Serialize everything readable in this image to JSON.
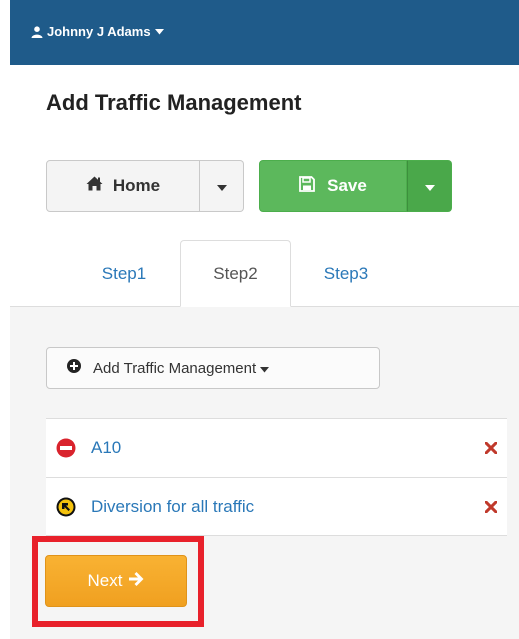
{
  "user": {
    "name": "Johnny J Adams"
  },
  "page": {
    "title": "Add Traffic Management"
  },
  "toolbar": {
    "home_label": "Home",
    "save_label": "Save"
  },
  "tabs": [
    {
      "label": "Step1",
      "active": false
    },
    {
      "label": "Step2",
      "active": true
    },
    {
      "label": "Step3",
      "active": false
    }
  ],
  "add_dropdown": {
    "label": "Add Traffic Management"
  },
  "traffic_items": [
    {
      "label": "A10",
      "icon": "no-entry-icon"
    },
    {
      "label": "Diversion for all traffic",
      "icon": "diversion-sign-icon"
    }
  ],
  "next": {
    "label": "Next"
  },
  "colors": {
    "topbar": "#1f5b8a",
    "save": "#5cb85c",
    "link": "#2a78b8",
    "next": "#f0a020",
    "highlight": "#e8212b",
    "remove": "#c0392b"
  }
}
